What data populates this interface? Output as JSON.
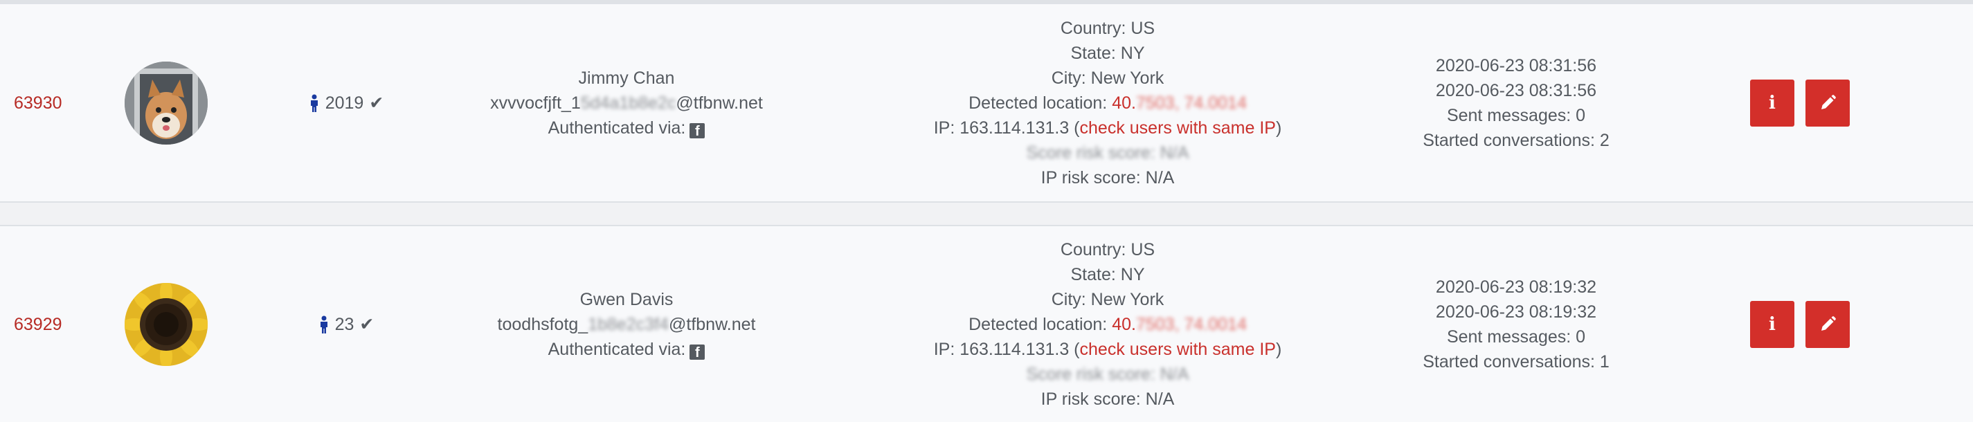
{
  "users": [
    {
      "id": "63930",
      "avatar_icon": "shiba-dog-photo",
      "age": "2019",
      "name": "Jimmy Chan",
      "email_prefix": "xvvvocfjft_1",
      "email_hidden": "5d4a1b8e2c",
      "email_domain": "@tfbnw.net",
      "auth_label": "Authenticated via:",
      "auth_icon": "facebook-icon",
      "country": "Country: US",
      "state": "State: NY",
      "city": "City: New York",
      "detected_label": "Detected location: ",
      "detected_value": "40.",
      "detected_hidden": "7503, 74.0014",
      "ip_prefix": "IP: 163.114.131.3 (",
      "ip_link": "check users with same IP",
      "ip_suffix": ")",
      "score_hidden": "Score risk score: N/A",
      "ip_risk": "IP risk score: N/A",
      "created": "2020-06-23 08:31:56",
      "updated": "2020-06-23 08:31:56",
      "sent": "Sent messages: 0",
      "conversations": "Started conversations: 2"
    },
    {
      "id": "63929",
      "avatar_icon": "sunflower-photo",
      "age": "23",
      "name": "Gwen Davis",
      "email_prefix": "toodhsfotg_",
      "email_hidden": "1b8e2c3f4",
      "email_domain": "@tfbnw.net",
      "auth_label": "Authenticated via:",
      "auth_icon": "facebook-icon",
      "country": "Country: US",
      "state": "State: NY",
      "city": "City: New York",
      "detected_label": "Detected location: ",
      "detected_value": "40.",
      "detected_hidden": "7503, 74.0014",
      "ip_prefix": "IP: 163.114.131.3 (",
      "ip_link": "check users with same IP",
      "ip_suffix": ")",
      "score_hidden": "Score risk score: N/A",
      "ip_risk": "IP risk score: N/A",
      "created": "2020-06-23 08:19:32",
      "updated": "2020-06-23 08:19:32",
      "sent": "Sent messages: 0",
      "conversations": "Started conversations: 1"
    }
  ],
  "actions": {
    "info_label": "i",
    "edit_icon": "pencil-icon"
  },
  "colors": {
    "accent": "#d32f2a",
    "link": "#c9302c",
    "person_icon": "#1a3aa0"
  }
}
